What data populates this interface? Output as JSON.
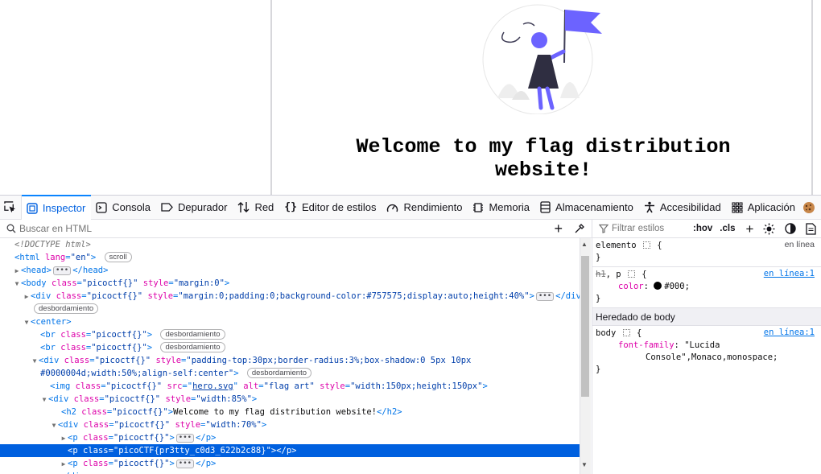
{
  "page": {
    "heading": "Welcome to my flag distribution website!"
  },
  "toolbar": {
    "tabs": [
      {
        "label": "Inspector",
        "icon": "inspector-icon"
      },
      {
        "label": "Consola",
        "icon": "console-icon"
      },
      {
        "label": "Depurador",
        "icon": "debugger-icon"
      },
      {
        "label": "Red",
        "icon": "network-icon"
      },
      {
        "label": "Editor de estilos",
        "icon": "style-editor-icon"
      },
      {
        "label": "Rendimiento",
        "icon": "performance-icon"
      },
      {
        "label": "Memoria",
        "icon": "memory-icon"
      },
      {
        "label": "Almacenamiento",
        "icon": "storage-icon"
      },
      {
        "label": "Accesibilidad",
        "icon": "accessibility-icon"
      },
      {
        "label": "Aplicación",
        "icon": "application-icon"
      }
    ],
    "active_tab": "Inspector"
  },
  "inspector": {
    "search_placeholder": "Buscar en HTML",
    "badges": {
      "scroll": "scroll",
      "overflow": "desbordamiento"
    },
    "lines": {
      "l1": "<!DOCTYPE html>",
      "html_attr": "lang",
      "html_val": "\"en\"",
      "body_class": "\"picoctf{}\"",
      "body_style": "\"margin:0\"",
      "div1_class": "\"picoctf{}\"",
      "div1_style": "\"margin:0;padding:0;background-color:#757575;display:auto;height:40%\"",
      "br_class": "\"picoctf{}\"",
      "div2_class": "\"picoctf{}\"",
      "div2_style_a": "\"padding-top:30px;border-radius:3%;box-shadow:0 5px 10px",
      "div2_style_b": "#0000004d;width:50%;align-self:center\"",
      "img_class": "\"picoctf{}\"",
      "img_src": "hero.svg",
      "img_alt": "\"flag art\"",
      "img_style": "\"width:150px;height:150px\"",
      "div3_class": "\"picoctf{}\"",
      "div3_style": "\"width:85%\"",
      "h2_class": "\"picoctf{}\"",
      "h2_text": "Welcome to my flag distribution website!",
      "div4_class": "\"picoctf{}\"",
      "div4_style": "\"width:70%\"",
      "p_class": "\"picoctf{}\"",
      "p_flag_class": "\"picoCTF{pr3tty_c0d3_622b2c88}\""
    }
  },
  "rules": {
    "filter_placeholder": "Filtrar estilos",
    "hov": ":hov",
    "cls": ".cls",
    "element_selector": "elemento",
    "inline_label": "en línea",
    "rule1_selector_strike": "h1",
    "rule1_selector": ", p",
    "rule1_source": "en línea:1",
    "rule1_prop": "color",
    "rule1_value": "#000",
    "inherited_header": "Heredado de body",
    "rule2_selector": "body",
    "rule2_source": "en línea:1",
    "rule2_prop": "font-family",
    "rule2_value_a": "\"Lucida",
    "rule2_value_b": "Console\",Monaco,monospace",
    "colors": {
      "swatch": "#000000",
      "accent": "#0a84ff",
      "selection": "#0060df"
    }
  }
}
